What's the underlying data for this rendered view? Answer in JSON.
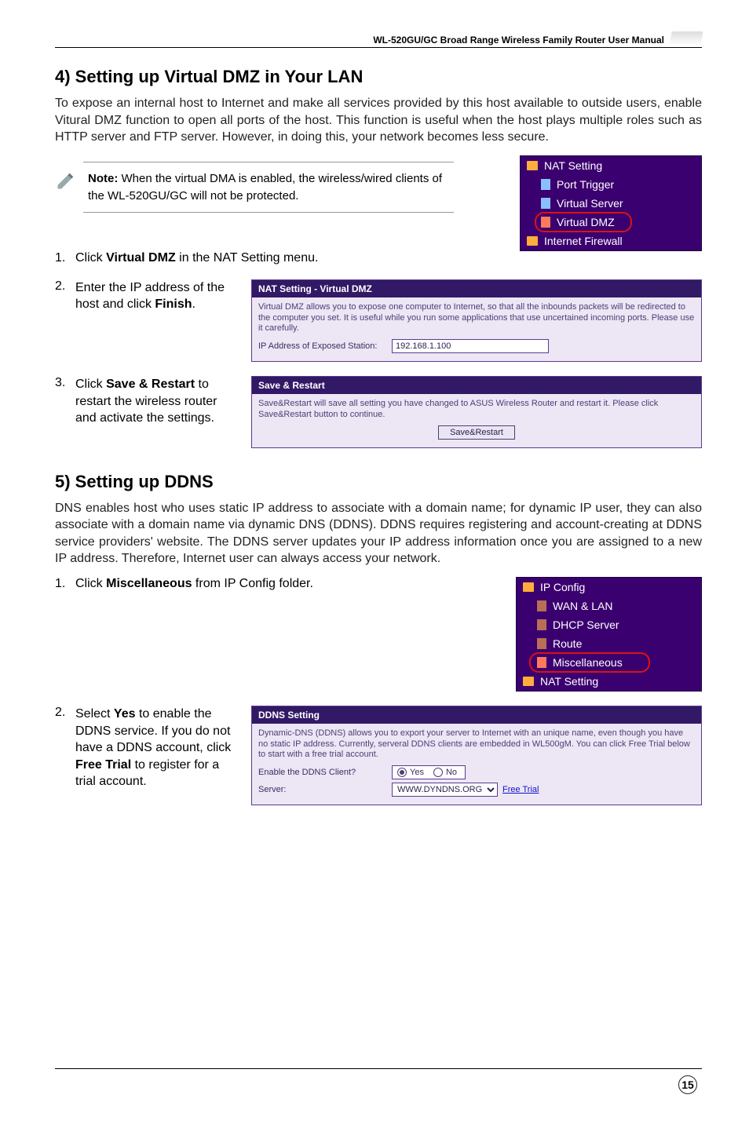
{
  "header": {
    "title": "WL-520GU/GC Broad Range Wireless Family Router User Manual"
  },
  "section4": {
    "heading": "4) Setting up Virtual DMZ in Your LAN",
    "intro": "To expose an internal host to Internet and make all services provided by this host available to outside users, enable Vitural DMZ function to open all ports of the host. This function is useful when the host plays multiple roles such as HTTP server and FTP server. However, in doing this, your network becomes less secure.",
    "note": {
      "bold": "Note:",
      "text": " When the virtual DMA is enabled, the wireless/wired clients of the WL-520GU/GC will not be protected."
    },
    "nat_menu": {
      "root": "NAT Setting",
      "items": [
        "Port Trigger",
        "Virtual Server",
        "Virtual DMZ"
      ],
      "next": "Internet Firewall"
    },
    "step1": {
      "text_a": "Click ",
      "bold": "Virtual DMZ",
      "text_b": " in the NAT Setting menu."
    },
    "step2": {
      "text_a": "Enter the IP address of the host and click ",
      "bold": "Finish",
      "text_b": "."
    },
    "dmz_panel": {
      "title": "NAT Setting - Virtual DMZ",
      "desc": "Virtual DMZ allows you to expose one computer to Internet, so that all the inbounds packets will be redirected to the computer you set. It is useful while you run some applications that use uncertained incoming ports. Please use it carefully.",
      "field_label": "IP Address of Exposed Station:",
      "field_value": "192.168.1.100"
    },
    "step3": {
      "text_a": "Click ",
      "bold": "Save & Restart",
      "text_b": " to restart the wireless router and activate the settings."
    },
    "save_panel": {
      "title": "Save & Restart",
      "desc": "Save&Restart will save all setting you have changed to ASUS Wireless Router and restart it. Please click Save&Restart button to continue.",
      "button": "Save&Restart"
    }
  },
  "section5": {
    "heading": "5) Setting up DDNS",
    "intro": "DNS enables host who uses static IP address to associate with a domain name; for dynamic IP user, they can also associate with a domain name via dynamic DNS (DDNS). DDNS requires registering and account-creating at DDNS service providers' website. The DDNS server updates your IP address information once you are assigned to a new IP address. Therefore, Internet user can always access your network.",
    "step1": {
      "text_a": "Click ",
      "bold": "Miscellaneous",
      "text_b": " from IP Config folder."
    },
    "ip_menu": {
      "root": "IP Config",
      "items": [
        "WAN & LAN",
        "DHCP Server",
        "Route",
        "Miscellaneous"
      ],
      "next": "NAT Setting"
    },
    "step2": {
      "text_full": "Select Yes to enable the DDNS service. If you do not have a DDNS account, click Free Trial to register for a trial account.",
      "text_a": "Select ",
      "bold_a": "Yes",
      "text_b": " to enable the DDNS service. If you do not have a DDNS account, click ",
      "bold_b": "Free Trial",
      "text_c": " to register for a trial account."
    },
    "ddns_panel": {
      "title": "DDNS Setting",
      "desc": "Dynamic-DNS (DDNS) allows you to export your server to Internet with an unique name, even though you have no static IP address. Currently, serveral DDNS clients are embedded in WL500gM. You can click Free Trial below to start with a free trial account.",
      "field1_label": "Enable the DDNS Client?",
      "radio_yes": "Yes",
      "radio_no": "No",
      "field2_label": "Server:",
      "server_value": "WWW.DYNDNS.ORG",
      "free_trial": "Free Trial"
    }
  },
  "footer": {
    "page": "15"
  }
}
